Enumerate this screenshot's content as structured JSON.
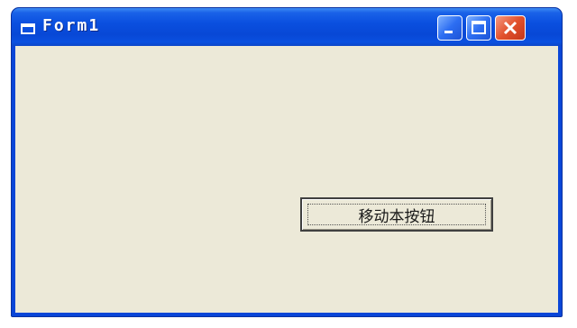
{
  "window": {
    "title": "Form1",
    "icon": "form-icon"
  },
  "controls": {
    "minimize_icon": "minimize-icon",
    "maximize_icon": "maximize-icon",
    "close_icon": "close-icon"
  },
  "form": {
    "button_label": "移动本按钮"
  },
  "colors": {
    "titlebar": "#0a4fdf",
    "client_background": "#ece9d8",
    "close_button": "#e2512c"
  }
}
